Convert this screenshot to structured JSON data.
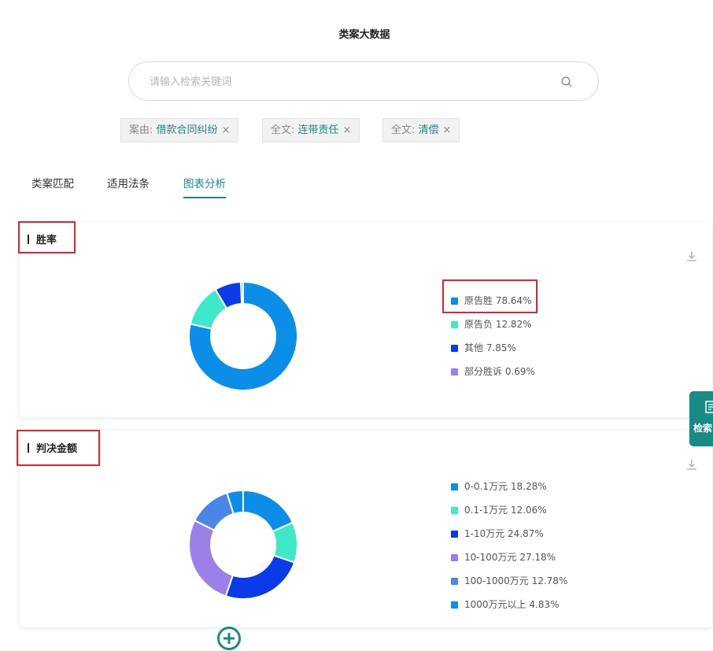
{
  "header": {
    "title": "类案大数据"
  },
  "search": {
    "placeholder": "请输入检索关键词",
    "value": "",
    "icon": "search-icon"
  },
  "filters": [
    {
      "key": "案由: ",
      "value": "借款合同纠纷"
    },
    {
      "key": "全文: ",
      "value": "连带责任"
    },
    {
      "key": "全文: ",
      "value": "清偿"
    }
  ],
  "filter_remove_glyph": "×",
  "tabs": [
    {
      "label": "类案匹配",
      "active": false
    },
    {
      "label": "适用法条",
      "active": false
    },
    {
      "label": "图表分析",
      "active": true
    }
  ],
  "accent_color": "#1a8a85",
  "side_widget": {
    "label": "检索",
    "icon": "document-icon"
  },
  "chart_data": [
    {
      "type": "pie",
      "donut": true,
      "title": "胜率",
      "categories": [
        "原告胜",
        "原告负",
        "其他",
        "部分胜诉"
      ],
      "values": [
        78.64,
        12.82,
        7.85,
        0.69
      ],
      "value_labels": [
        "78.64%",
        "12.82%",
        "7.85%",
        "0.69%"
      ],
      "colors": [
        "#0a8ee8",
        "#3ee8c8",
        "#0a3be8",
        "#9a80e8"
      ],
      "legend": "right"
    },
    {
      "type": "pie",
      "donut": true,
      "title": "判决金额",
      "categories": [
        "0-0.1万元",
        "0.1-1万元",
        "1-10万元",
        "10-100万元",
        "100-1000万元",
        "1000万元以上"
      ],
      "values": [
        18.28,
        12.06,
        24.87,
        27.18,
        12.78,
        4.83
      ],
      "value_labels": [
        "18.28%",
        "12.06%",
        "24.87%",
        "27.18%",
        "12.78%",
        "4.83%"
      ],
      "colors": [
        "#0a8ee8",
        "#3ee8c8",
        "#0a3be8",
        "#9a80e8",
        "#4a85e8",
        "#0a8ee8"
      ],
      "legend": "right"
    }
  ]
}
